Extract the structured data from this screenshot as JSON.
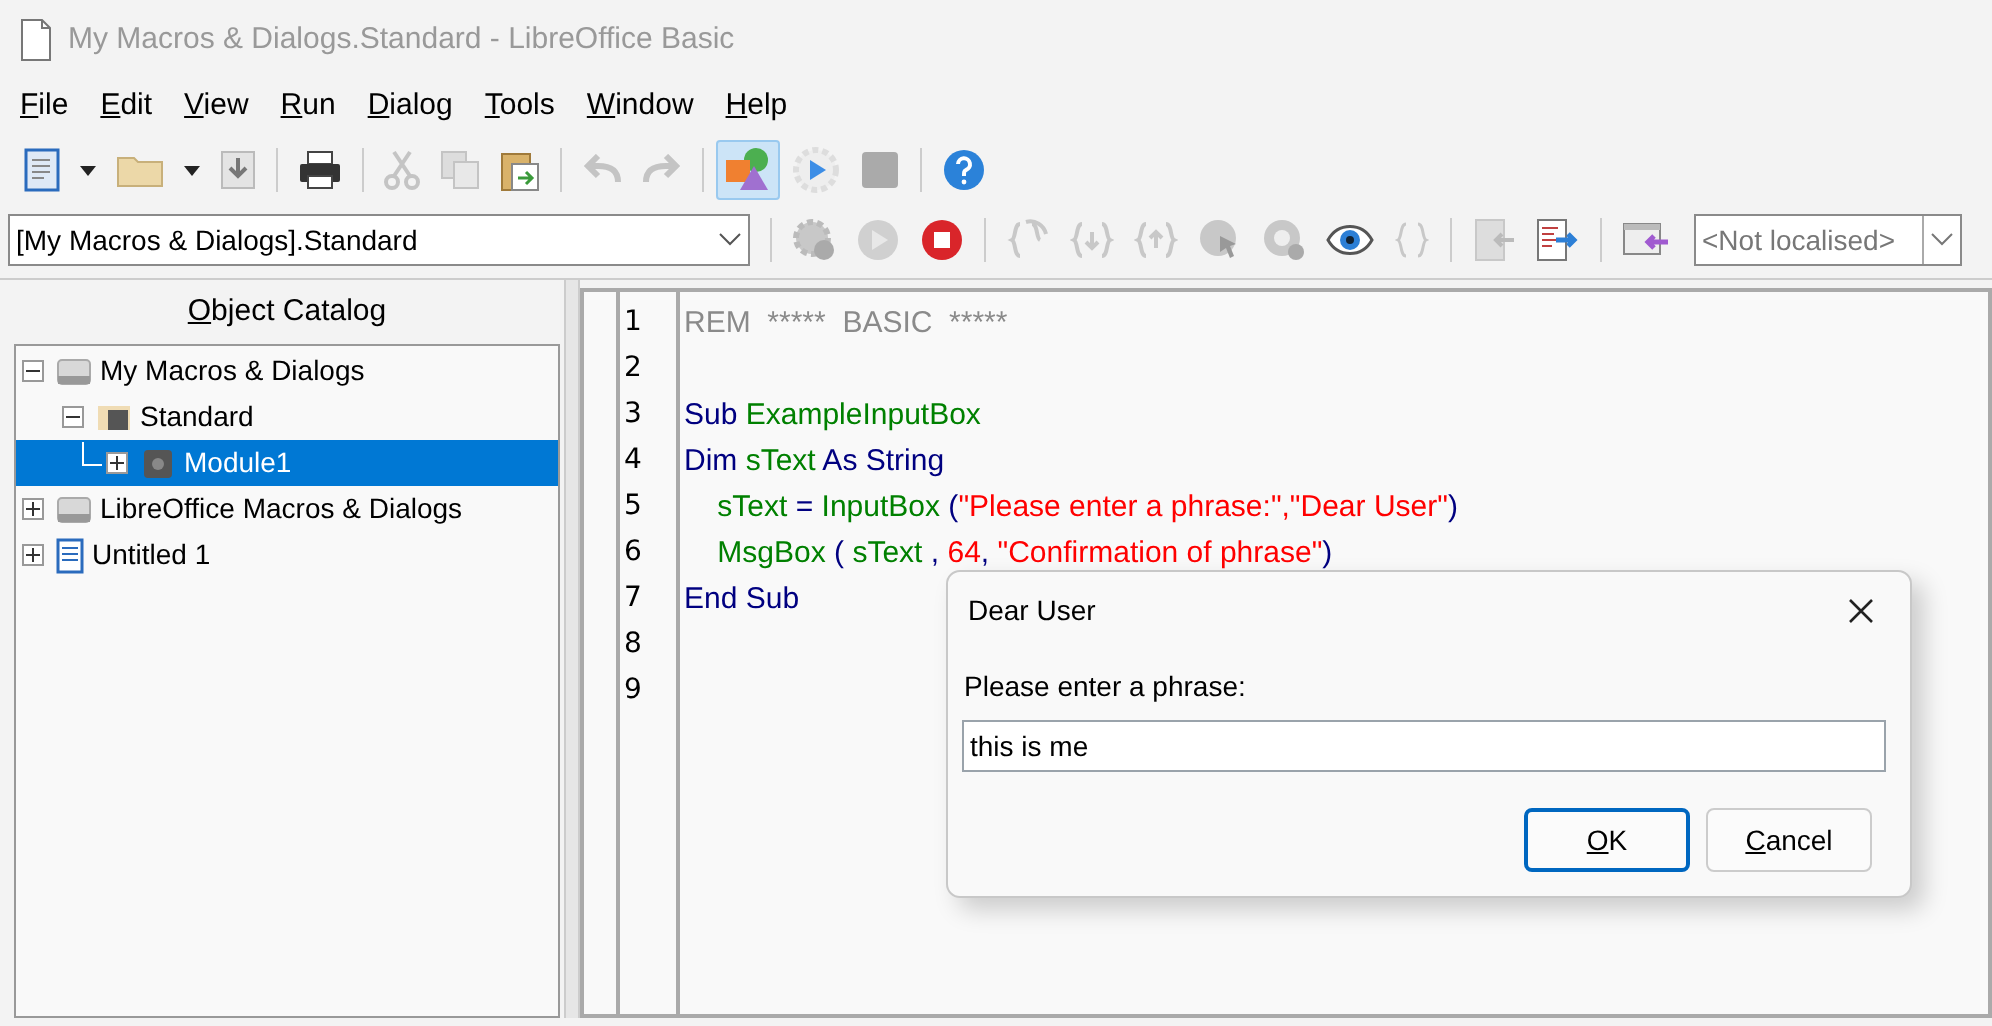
{
  "window": {
    "title": "My Macros & Dialogs.Standard - LibreOffice Basic"
  },
  "menu": [
    "File",
    "Edit",
    "View",
    "Run",
    "Dialog",
    "Tools",
    "Window",
    "Help"
  ],
  "library_selector": {
    "value": "[My Macros & Dialogs].Standard"
  },
  "language_selector": {
    "value": "<Not localised>"
  },
  "object_catalog": {
    "title": "Object Catalog",
    "tree": [
      {
        "label": "My Macros & Dialogs",
        "kind": "drive",
        "expanded": true,
        "selected": false,
        "children": [
          {
            "label": "Standard",
            "kind": "library",
            "expanded": true,
            "selected": false,
            "children": [
              {
                "label": "Module1",
                "kind": "module",
                "expanded": false,
                "selected": true
              }
            ]
          }
        ]
      },
      {
        "label": "LibreOffice Macros & Dialogs",
        "kind": "drive",
        "expanded": false,
        "selected": false
      },
      {
        "label": "Untitled 1",
        "kind": "document",
        "expanded": false,
        "selected": false
      }
    ]
  },
  "editor": {
    "lines": [
      {
        "number": "1",
        "tokens": [
          {
            "kind": "comment",
            "text": "REM  *****  BASIC  *****"
          }
        ]
      },
      {
        "number": "2"
      },
      {
        "number": "3",
        "tokens": [
          {
            "kind": "keyword",
            "text": "Sub "
          },
          {
            "kind": "identifier",
            "text": "ExampleInputBox"
          }
        ]
      },
      {
        "number": "4",
        "tokens": [
          {
            "kind": "keyword",
            "text": "Dim "
          },
          {
            "kind": "identifier",
            "text": "sText"
          },
          {
            "kind": "keyword",
            "text": " As String"
          }
        ]
      },
      {
        "number": "5",
        "tokens": [
          {
            "kind": "identifier",
            "text": "    sText"
          },
          {
            "kind": "keyword",
            "text": " = "
          },
          {
            "kind": "identifier",
            "text": "InputBox"
          },
          {
            "kind": "keyword",
            "text": " ("
          },
          {
            "kind": "string",
            "text": "\"Please enter a phrase:\",\"Dear User\""
          },
          {
            "kind": "keyword",
            "text": ")"
          }
        ]
      },
      {
        "number": "6",
        "tokens": [
          {
            "kind": "identifier",
            "text": "    MsgBox"
          },
          {
            "kind": "keyword",
            "text": " ( "
          },
          {
            "kind": "identifier",
            "text": "sText"
          },
          {
            "kind": "keyword",
            "text": " , "
          },
          {
            "kind": "number",
            "text": "64"
          },
          {
            "kind": "keyword",
            "text": ", "
          },
          {
            "kind": "string",
            "text": "\"Confirmation of phrase\""
          },
          {
            "kind": "keyword",
            "text": ")"
          }
        ]
      },
      {
        "number": "7",
        "tokens": [
          {
            "kind": "keyword",
            "text": "End Sub"
          }
        ]
      },
      {
        "number": "8"
      },
      {
        "number": "9"
      }
    ]
  },
  "dialog": {
    "title": "Dear User",
    "prompt": "Please enter a phrase:",
    "value": "this is me",
    "buttons": [
      {
        "label": "OK",
        "default": true
      },
      {
        "label": "Cancel",
        "default": false
      }
    ]
  }
}
